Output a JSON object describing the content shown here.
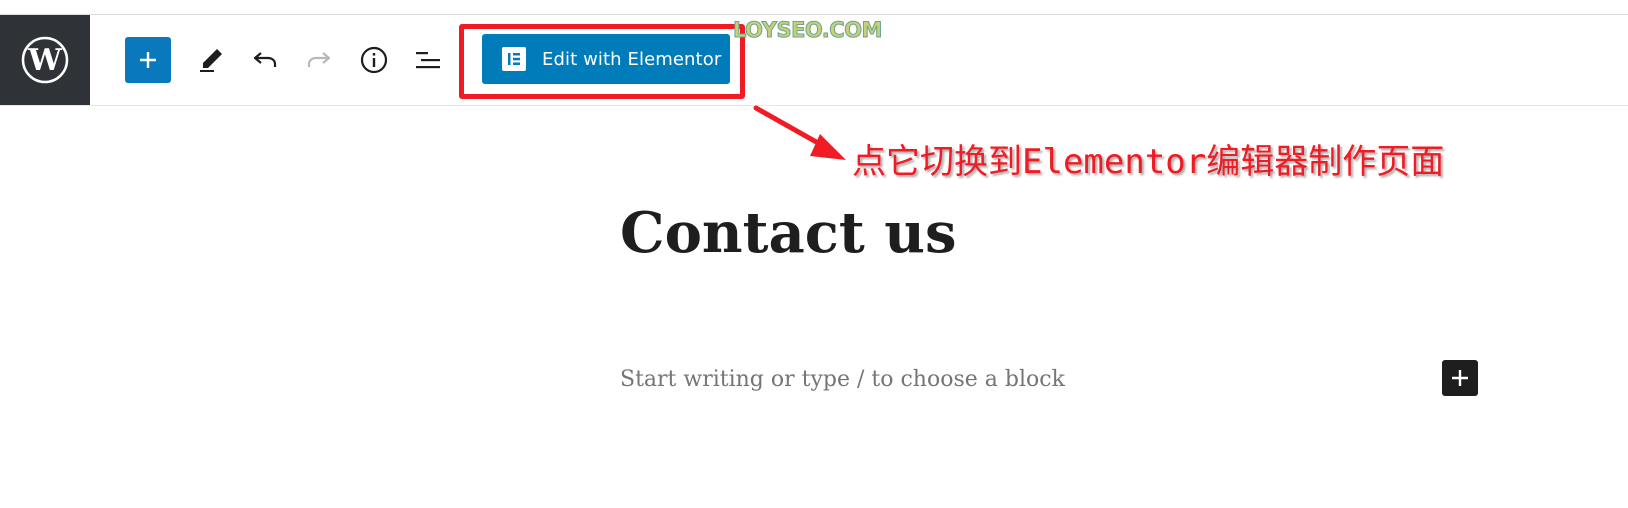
{
  "toolbar": {
    "logo_icon": "wordpress-icon",
    "tools": [
      {
        "name": "add-block",
        "icon": "plus-icon"
      },
      {
        "name": "tools",
        "icon": "pencil-icon"
      },
      {
        "name": "undo",
        "icon": "undo-icon"
      },
      {
        "name": "redo",
        "icon": "redo-icon",
        "state": "disabled"
      },
      {
        "name": "details",
        "icon": "info-icon"
      },
      {
        "name": "list-view",
        "icon": "list-view-icon"
      }
    ],
    "elementor_button": {
      "label": "Edit with Elementor",
      "icon": "elementor-icon"
    }
  },
  "watermark": {
    "text": "LOYSEO.COM"
  },
  "annotation": {
    "text": "点它切换到Elementor编辑器制作页面",
    "color": "#ef1c25"
  },
  "editor": {
    "title": "Contact us",
    "placeholder": "Start writing or type / to choose a block"
  },
  "colors": {
    "accent": "#007cba",
    "logo_bg": "#2f3337",
    "highlight": "#ef1c25",
    "dark": "#1e1e1e"
  }
}
